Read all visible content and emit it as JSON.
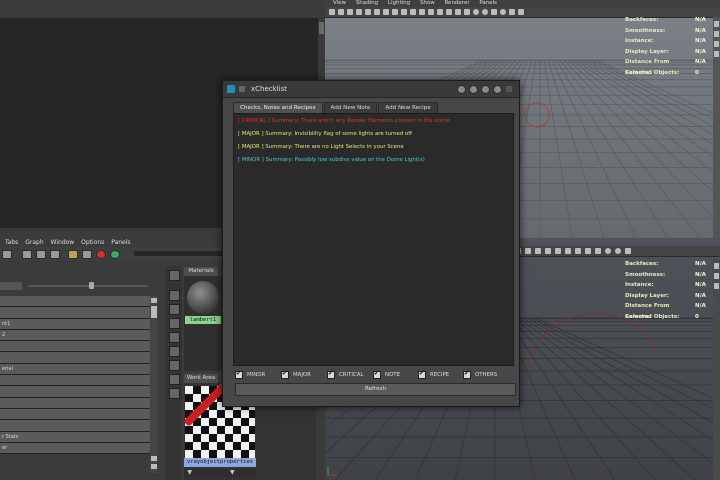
{
  "top_viewport": {
    "menu": [
      "View",
      "Shading",
      "Lighting",
      "Show",
      "Renderer",
      "Panels"
    ],
    "hud": [
      {
        "label": "Backfaces:",
        "value": "N/A"
      },
      {
        "label": "Smoothness:",
        "value": "N/A"
      },
      {
        "label": "Instance:",
        "value": "N/A"
      },
      {
        "label": "Display Layer:",
        "value": "N/A"
      },
      {
        "label": "Distance From Camera:",
        "value": "N/A"
      },
      {
        "label": "Selected Objects:",
        "value": "0"
      }
    ]
  },
  "bottom_viewport": {
    "hud": [
      {
        "label": "Backfaces:",
        "value": "N/A"
      },
      {
        "label": "Smoothness:",
        "value": "N/A"
      },
      {
        "label": "Instance:",
        "value": "N/A"
      },
      {
        "label": "Display Layer:",
        "value": "N/A"
      },
      {
        "label": "Distance From Camera:",
        "value": "N/A"
      },
      {
        "label": "Selected Objects:",
        "value": "0"
      }
    ]
  },
  "graph_editor": {
    "menu": [
      "Tabs",
      "Graph",
      "Window",
      "Options",
      "Panels"
    ],
    "rows": [
      "",
      "",
      "nt1",
      "2",
      "",
      "",
      "erial",
      "",
      "",
      "",
      "",
      "",
      "r Stats",
      "er"
    ]
  },
  "material_panel": {
    "tab_label": "Materials",
    "material_name": "lambert1",
    "work_tab_label": "Work Area",
    "node_name": "vrayobjectproperties",
    "node_arrows": "▼ ▼"
  },
  "dialog": {
    "title": "xChecklist",
    "tabs": [
      "Checks, Notes and Recipes",
      "Add New Note",
      "Add New Recipe"
    ],
    "messages": [
      {
        "text": "[ CRITICAL ] Summary: There aren't any Render Elements present in the scene",
        "color": "#d83a2c"
      },
      {
        "text": "[ MAJOR ] Summary: Invisibility flag of some lights are turned off",
        "color": "#e8e87a"
      },
      {
        "text": "[ MAJOR ] Summary: There are no Light Selects in your Scene",
        "color": "#e8e87a"
      },
      {
        "text": "[ MINOR ] Summary: Possibly low subdivs value on the Dome Light(s)",
        "color": "#4fc6e0"
      }
    ],
    "filters": [
      "MINOR",
      "MAJOR",
      "CRITICAL",
      "NOTE",
      "RECIPE",
      "OTHERS"
    ],
    "refresh_label": "Refresh"
  },
  "colors": {
    "critical": "#d83a2c",
    "major": "#e8e87a",
    "minor": "#4fc6e0",
    "hud_text": "#e9e9c0",
    "material_label_bg": "#8ad38a",
    "node_label_bg": "#8fa7e0"
  }
}
